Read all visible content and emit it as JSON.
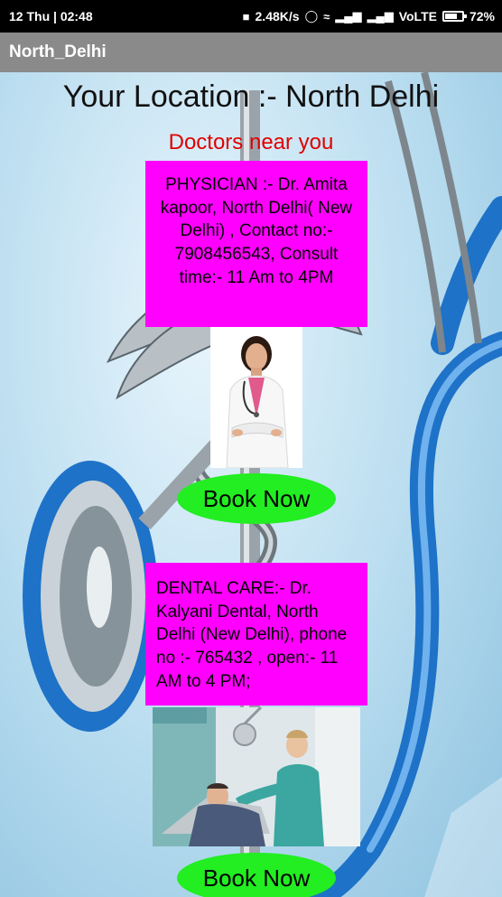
{
  "status_bar": {
    "left_text": "12 Thu | 02:48",
    "speed": "2.48K/s",
    "network": "VoLTE",
    "battery": "72%",
    "battery_level": 0.72
  },
  "app_bar": {
    "title": "North_Delhi"
  },
  "main": {
    "location_title": "Your Location :- North Delhi",
    "subtitle": "Doctors near you",
    "doctors": [
      {
        "info": "PHYSICIAN :- Dr. Amita kapoor, North Delhi( New Delhi) , Contact no:- 7908456543, Consult time:- 11 Am to 4PM",
        "button_label": "Book Now"
      },
      {
        "info": "DENTAL CARE:- Dr. Kalyani Dental, North Delhi (New Delhi), phone no :- 765432 , open:- 11 AM to 4 PM;",
        "button_label": "Book Now"
      }
    ]
  },
  "colors": {
    "card_bg": "#ff00ff",
    "button_bg": "#22ee22",
    "subtitle": "#e00000",
    "app_bar": "#8a8a8a"
  }
}
